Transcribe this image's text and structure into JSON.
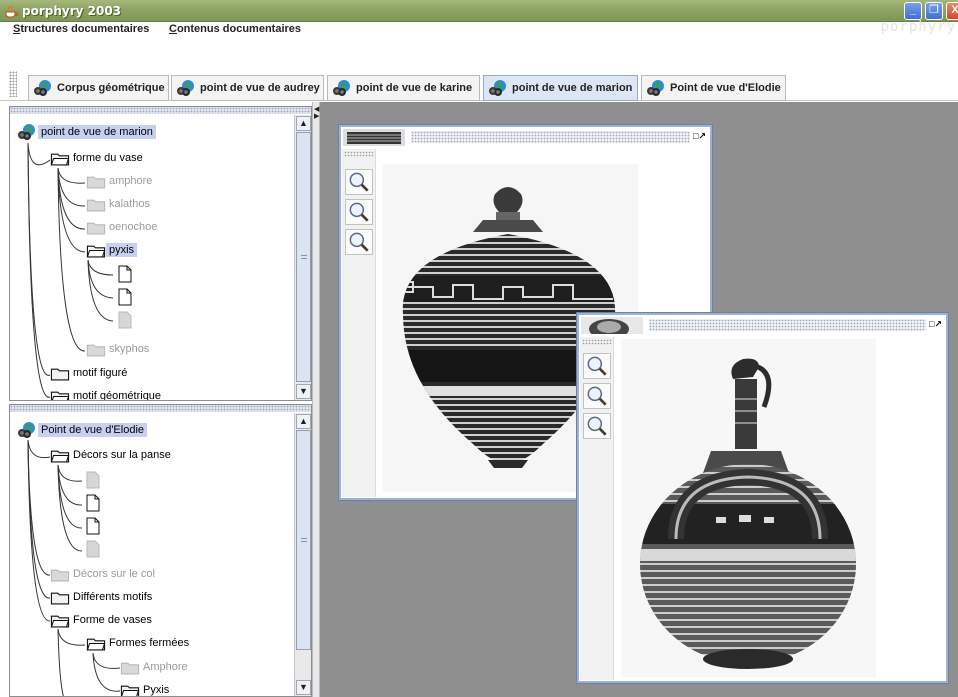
{
  "window": {
    "title": "porphyry 2003",
    "brand": "porphyry",
    "controls": [
      "minimize",
      "restore",
      "close"
    ]
  },
  "menu": {
    "items": [
      {
        "mnemonic": "S",
        "rest": "tructures documentaires"
      },
      {
        "mnemonic": "C",
        "rest": "ontenus documentaires"
      }
    ]
  },
  "tabs": [
    {
      "label": "Corpus géométrique",
      "active": false
    },
    {
      "label": "point de vue de audrey",
      "active": false
    },
    {
      "label": "point de vue de karine",
      "active": false
    },
    {
      "label": "point de vue de marion",
      "active": true
    },
    {
      "label": "Point de vue d'Elodie",
      "active": false
    }
  ],
  "tree_top": {
    "root": "point de vue de marion",
    "nodes": [
      {
        "label": "forme du vase",
        "kind": "folder-open",
        "level": 1,
        "dim": false
      },
      {
        "label": "amphore",
        "kind": "folder",
        "level": 2,
        "dim": true
      },
      {
        "label": "kalathos",
        "kind": "folder",
        "level": 2,
        "dim": true
      },
      {
        "label": "oenochoe",
        "kind": "folder",
        "level": 2,
        "dim": true
      },
      {
        "label": "pyxis",
        "kind": "folder-open",
        "level": 2,
        "dim": false,
        "selected": true
      },
      {
        "label": "",
        "kind": "doc",
        "level": 3,
        "dim": false
      },
      {
        "label": "",
        "kind": "doc",
        "level": 3,
        "dim": false
      },
      {
        "label": "",
        "kind": "doc",
        "level": 3,
        "dim": true
      },
      {
        "label": "skyphos",
        "kind": "folder",
        "level": 2,
        "dim": true
      },
      {
        "label": "motif figuré",
        "kind": "folder",
        "level": 1,
        "dim": false
      },
      {
        "label": "motif géométrique",
        "kind": "folder-open",
        "level": 1,
        "dim": false
      }
    ]
  },
  "tree_bottom": {
    "root": "Point de vue d'Elodie",
    "nodes": [
      {
        "label": "Décors sur la panse",
        "kind": "folder-open",
        "level": 1,
        "dim": false
      },
      {
        "label": "",
        "kind": "doc",
        "level": 2,
        "dim": true
      },
      {
        "label": "",
        "kind": "doc",
        "level": 2,
        "dim": false
      },
      {
        "label": "",
        "kind": "doc",
        "level": 2,
        "dim": false
      },
      {
        "label": "",
        "kind": "doc",
        "level": 2,
        "dim": true
      },
      {
        "label": "Décors sur le col",
        "kind": "folder",
        "level": 1,
        "dim": true
      },
      {
        "label": "Différents motifs",
        "kind": "folder",
        "level": 1,
        "dim": false
      },
      {
        "label": "Forme de vases",
        "kind": "folder-open",
        "level": 1,
        "dim": false
      },
      {
        "label": "Formes fermées",
        "kind": "folder-open",
        "level": 2,
        "dim": false
      },
      {
        "label": "Amphore",
        "kind": "folder",
        "level": 3,
        "dim": true
      },
      {
        "label": "Pyxis",
        "kind": "folder-open",
        "level": 3,
        "dim": false
      }
    ]
  },
  "viewer_windows": [
    {
      "name": "pyxis-image-viewer",
      "subject": "pyxis vase photograph",
      "tools": [
        "zoom-out-icon",
        "zoom-reset-icon",
        "zoom-fit-icon"
      ]
    },
    {
      "name": "oenochoe-image-viewer",
      "subject": "amphora with oinochoe photograph",
      "tools": [
        "zoom-out-icon",
        "zoom-reset-icon",
        "zoom-fit-icon"
      ]
    }
  ],
  "colors": {
    "titlebar": "#8ea463",
    "selection": "#c8d0f2",
    "active_tab": "#dde6f5",
    "desktop": "#8f8f8f",
    "frame_border": "#9fb2d6"
  }
}
